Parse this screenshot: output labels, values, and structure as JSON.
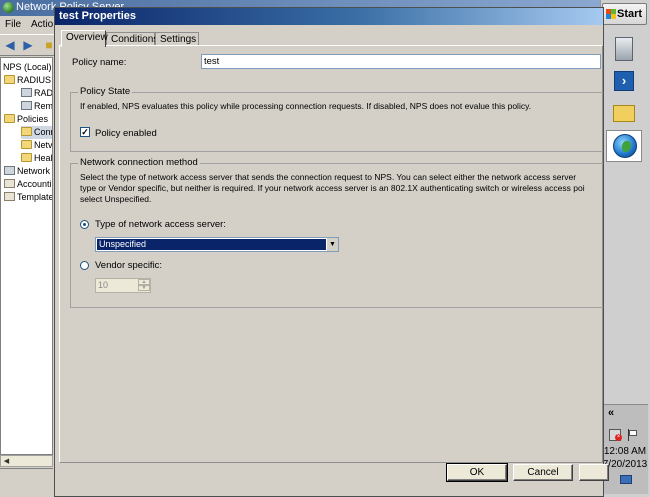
{
  "bg_window": {
    "title": "Network Policy Server",
    "menu": [
      "File",
      "Actio"
    ],
    "tree": [
      {
        "label": "NPS (Local)",
        "icon": "server-icon"
      },
      {
        "label": "RADIUS",
        "icon": "folder-icon"
      },
      {
        "label": "RAD",
        "icon": "server-icon"
      },
      {
        "label": "Rem",
        "icon": "server-icon"
      },
      {
        "label": "Policies",
        "icon": "folder-icon"
      },
      {
        "label": "Conn",
        "icon": "folder-icon"
      },
      {
        "label": "Netv",
        "icon": "folder-icon"
      },
      {
        "label": "Heal",
        "icon": "folder-icon"
      },
      {
        "label": "Network",
        "icon": "server-icon"
      },
      {
        "label": "Accounti",
        "icon": "policy-icon"
      },
      {
        "label": "Template",
        "icon": "policy-icon"
      }
    ]
  },
  "dialog": {
    "title": "test Properties",
    "tabs": [
      {
        "label": "Overview",
        "active": true
      },
      {
        "label": "Conditions",
        "active": false
      },
      {
        "label": "Settings",
        "active": false
      }
    ],
    "policy_name_label": "Policy name:",
    "policy_name_value": "test",
    "policy_state": {
      "group_title": "Policy State",
      "description": "If enabled, NPS evaluates this policy while processing connection requests. If disabled, NPS does not evalue this policy.",
      "enabled_label": "Policy enabled",
      "enabled_checked": true
    },
    "connection_method": {
      "group_title": "Network connection method",
      "description_lines": [
        "Select the type of network access server that sends the connection request to NPS. You can select either the network access server",
        "type or Vendor specific, but neither is required.  If your network access server is an 802.1X authenticating switch or wireless access poi",
        "select Unspecified."
      ],
      "type_label": "Type of network access server:",
      "type_selected": true,
      "type_value": "Unspecified",
      "vendor_label": "Vendor specific:",
      "vendor_selected": false,
      "vendor_value": "10"
    },
    "buttons": {
      "ok": "OK",
      "cancel": "Cancel"
    }
  },
  "taskbar": {
    "start_label": "Start",
    "tray_chevron": "«",
    "clock_time": "12:08 AM",
    "clock_date": "7/20/2013"
  }
}
